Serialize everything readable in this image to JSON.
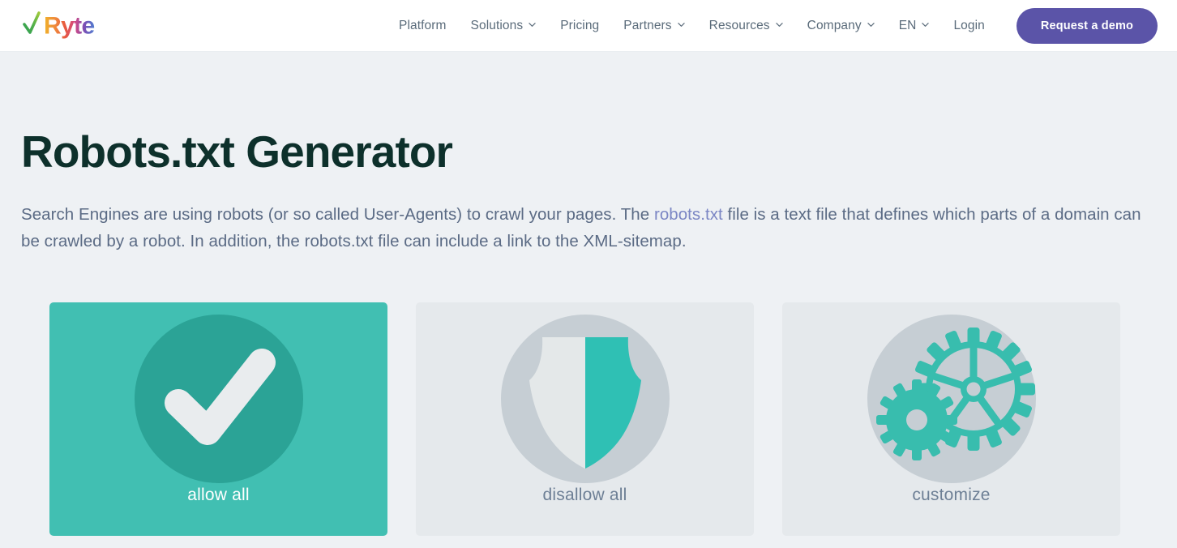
{
  "header": {
    "logo_text": "Ryte",
    "logo_icon": "check-icon",
    "nav": [
      {
        "label": "Platform",
        "has_caret": false,
        "caret_icon": "chevron-down-icon"
      },
      {
        "label": "Solutions",
        "has_caret": true,
        "caret_icon": "chevron-down-icon"
      },
      {
        "label": "Pricing",
        "has_caret": false,
        "caret_icon": "chevron-down-icon"
      },
      {
        "label": "Partners",
        "has_caret": true,
        "caret_icon": "chevron-down-icon"
      },
      {
        "label": "Resources",
        "has_caret": true,
        "caret_icon": "chevron-down-icon"
      },
      {
        "label": "Company",
        "has_caret": true,
        "caret_icon": "chevron-down-icon"
      },
      {
        "label": "EN",
        "has_caret": true,
        "caret_icon": "chevron-down-icon"
      },
      {
        "label": "Login",
        "has_caret": false,
        "caret_icon": "chevron-down-icon"
      }
    ],
    "cta_label": "Request a demo"
  },
  "main": {
    "title": "Robots.txt Generator",
    "lead_part1": "Search Engines are using robots (or so called User-Agents) to crawl your pages. The ",
    "lead_link": "robots.txt",
    "lead_part2": " file is a text file that defines which parts of a domain can be crawled by a robot. In addition, the robots.txt file can include a link to the XML-sitemap.",
    "options": [
      {
        "label": "allow all",
        "icon": "check-circle-icon",
        "selected": true
      },
      {
        "label": "disallow all",
        "icon": "shield-icon",
        "selected": false
      },
      {
        "label": "customize",
        "icon": "gears-icon",
        "selected": false
      }
    ]
  },
  "colors": {
    "page_background": "#eef1f4",
    "header_background": "#ffffff",
    "accent_teal": "#41bfb2",
    "accent_teal_dark": "#2ba396",
    "cta_purple": "#5b54a8",
    "title_dark_green": "#0d302b",
    "body_text": "#5b6b85",
    "link_purple": "#7b86c4",
    "card_grey": "#e5e9ec",
    "circle_grey": "#c6ced4",
    "label_grey": "#6d7f95"
  }
}
